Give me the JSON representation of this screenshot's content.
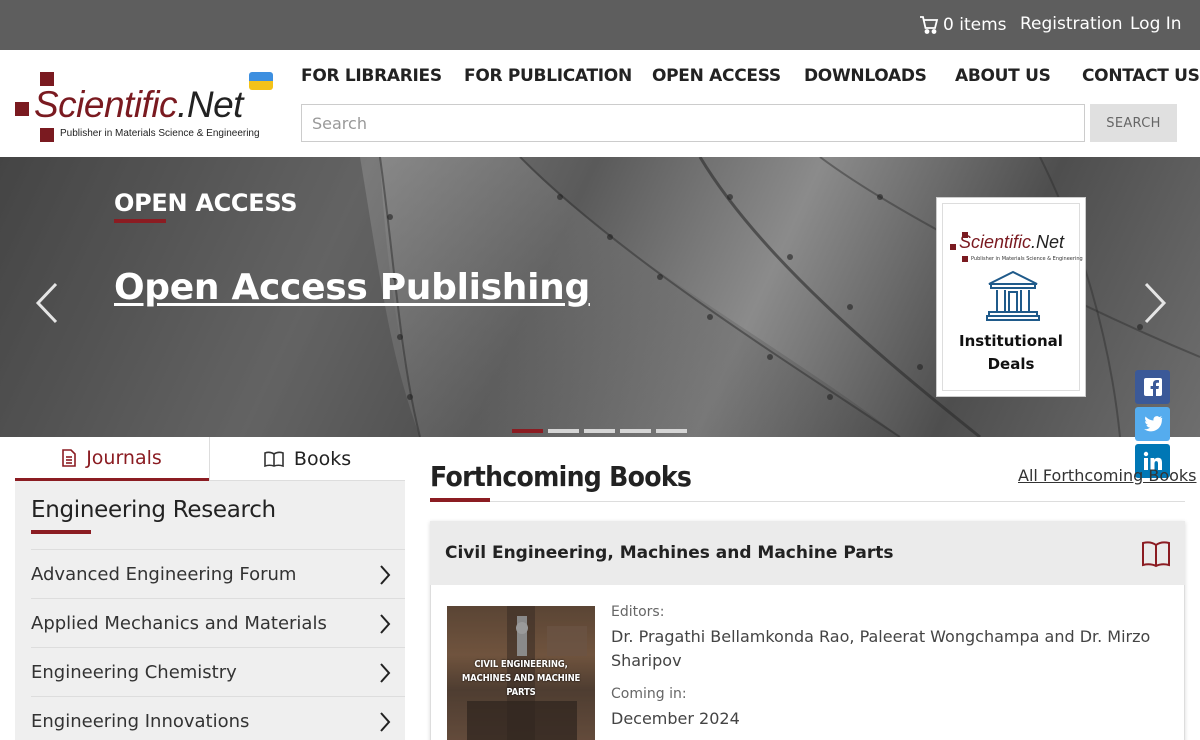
{
  "topbar": {
    "cart_label": "0 items",
    "registration": "Registration",
    "login": "Log In"
  },
  "logo": {
    "name_part1": "Scientific",
    "name_part2": ".Net",
    "tagline": "Publisher in Materials Science & Engineering"
  },
  "nav": {
    "items": [
      "FOR LIBRARIES",
      "FOR PUBLICATION",
      "OPEN ACCESS",
      "DOWNLOADS",
      "ABOUT US",
      "CONTACT US"
    ]
  },
  "search": {
    "placeholder": "Search",
    "button": "SEARCH"
  },
  "hero": {
    "kicker": "OPEN ACCESS",
    "headline": "Open Access Publishing",
    "promo": {
      "logo_part1": "Scientific",
      "logo_part2": ".Net",
      "logo_tagline": "Publisher in Materials Science & Engineering",
      "caption_line1": "Institutional",
      "caption_line2": "Deals"
    },
    "slide_count": 5,
    "active_slide": 1
  },
  "left_panel": {
    "tabs": [
      "Journals",
      "Books"
    ],
    "active_tab": "Journals",
    "section_title": "Engineering Research",
    "journals": [
      "Advanced Engineering Forum",
      "Applied Mechanics and Materials",
      "Engineering Chemistry",
      "Engineering Innovations"
    ]
  },
  "forthcoming": {
    "title": "Forthcoming Books",
    "all_link": "All Forthcoming Books",
    "book": {
      "title": "Civil Engineering, Machines and Machine Parts",
      "cover_text": "CIVIL ENGINEERING, MACHINES AND MACHINE PARTS",
      "editors_label": "Editors:",
      "editors": "Dr. Pragathi Bellamkonda Rao, Paleerat Wongchampa and Dr. Mirzo Sharipov",
      "coming_label": "Coming in:",
      "coming_date": "December 2024"
    }
  },
  "colors": {
    "brand": "#8b1c22",
    "topbar": "#5e5e5e",
    "facebook": "#3b5998",
    "twitter": "#55acee",
    "linkedin": "#0077b5"
  }
}
